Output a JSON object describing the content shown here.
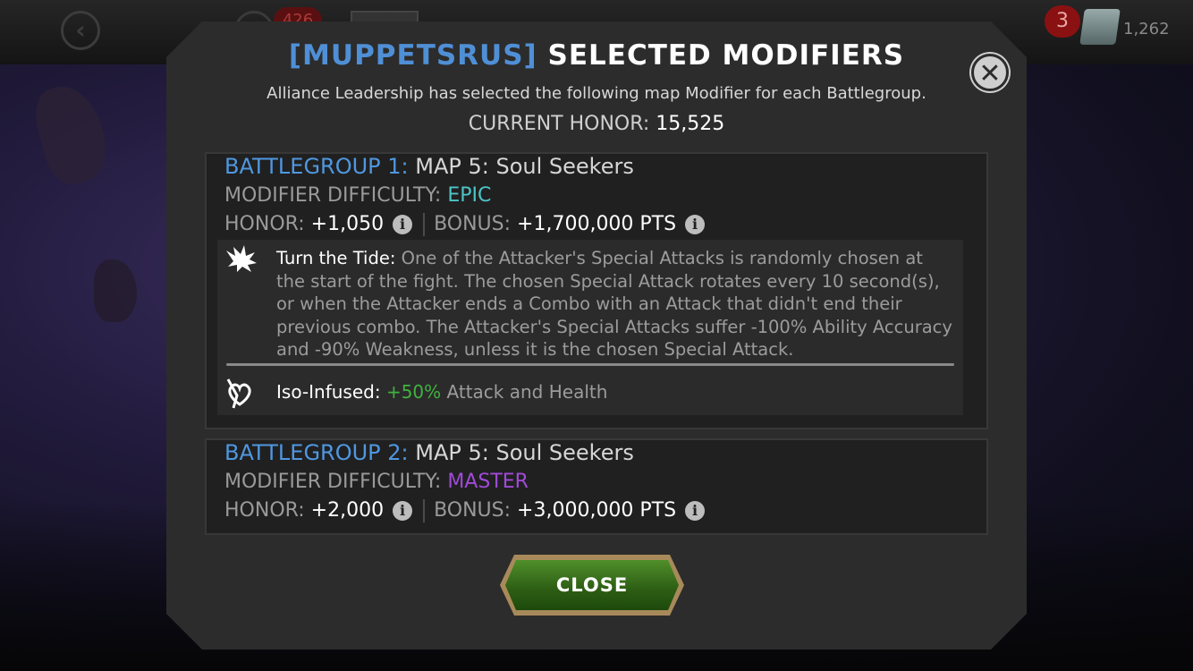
{
  "background": {
    "back_icon": "chevron-left-icon",
    "badge_value": "426",
    "notification_count": "3",
    "currency_value": "1,262"
  },
  "modal": {
    "title_tag": "[MUPPETSRUS]",
    "title_rest": " SELECTED MODIFIERS",
    "subtitle": "Alliance Leadership has selected the following map Modifier for each Battlegroup.",
    "current_honor_label": "CURRENT HONOR: ",
    "current_honor_value": "15,525",
    "close_x": "✕",
    "close_button": "CLOSE"
  },
  "battlegroups": [
    {
      "label": "BATTLEGROUP 1:",
      "map": " MAP 5: Soul Seekers",
      "difficulty_label": "MODIFIER DIFFICULTY: ",
      "difficulty": "EPIC",
      "honor_label": "HONOR: ",
      "honor_value": "+1,050",
      "bonus_label": "BONUS: ",
      "bonus_value": "+1,700,000 PTS",
      "modifiers": [
        {
          "icon": "splash-icon",
          "name": "Turn the Tide:",
          "description": " One of the Attacker's Special Attacks is randomly chosen at the start of the fight. The chosen Special Attack rotates every 10 second(s), or when the Attacker ends a Combo with an Attack that didn't end their previous combo. The Attacker's Special Attacks suffer -100% Ability Accuracy and -90% Weakness, unless it is the chosen Special Attack."
        },
        {
          "icon": "heart-sword-icon",
          "name": "Iso-Infused:",
          "highlight": " +50%",
          "description": " Attack and Health"
        }
      ]
    },
    {
      "label": "BATTLEGROUP 2:",
      "map": " MAP 5: Soul Seekers",
      "difficulty_label": "MODIFIER DIFFICULTY: ",
      "difficulty": "MASTER",
      "honor_label": "HONOR: ",
      "honor_value": "+2,000",
      "bonus_label": "BONUS: ",
      "bonus_value": "+3,000,000 PTS"
    }
  ],
  "colors": {
    "battlegroup_blue": "#4f97e0",
    "epic_teal": "#4cc4c8",
    "master_purple": "#a04ad8",
    "bonus_green": "#3fb23f",
    "button_green": "#2d5d14"
  }
}
